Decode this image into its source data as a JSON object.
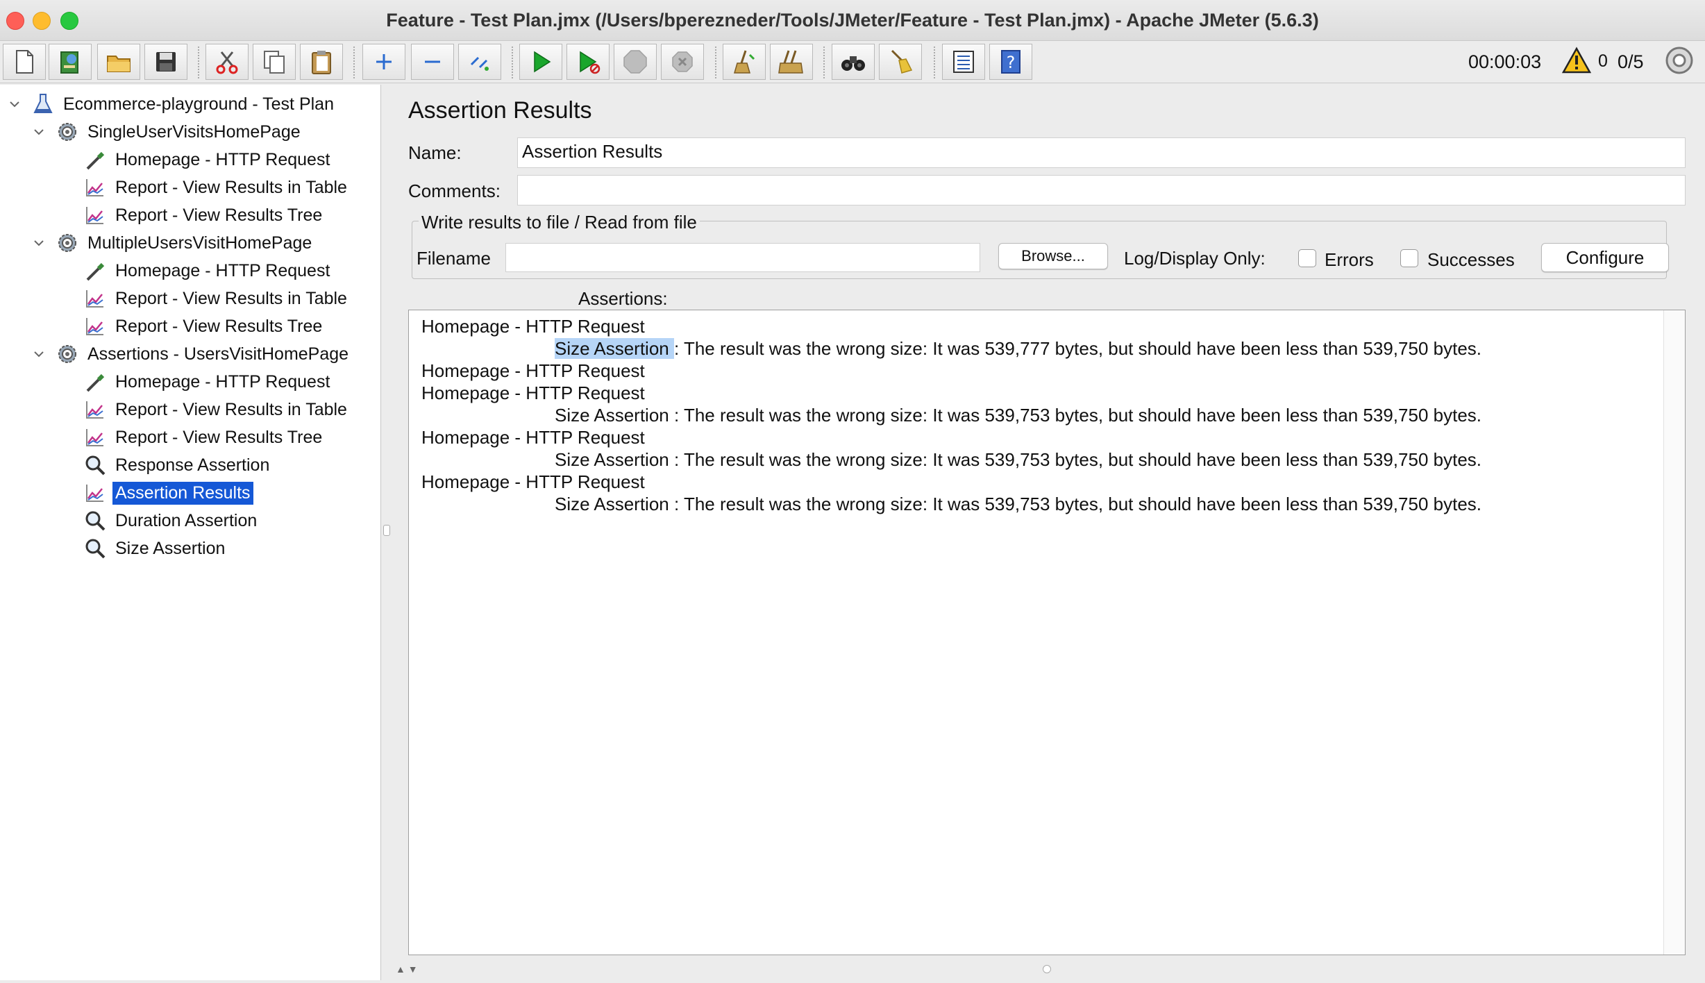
{
  "window": {
    "title": "Feature - Test Plan.jmx (/Users/bperezneder/Tools/JMeter/Feature - Test Plan.jmx) - Apache JMeter (5.6.3)"
  },
  "toolbar": {
    "buttons": [
      "new-icon",
      "templates-icon",
      "open-icon",
      "save-icon",
      "cut-icon",
      "copy-icon",
      "paste-icon",
      "expand-icon",
      "collapse-icon",
      "toggle-icon",
      "start-icon",
      "start-no-pauses-icon",
      "stop-icon",
      "shutdown-icon",
      "clear-icon",
      "clear-all-icon",
      "search-icon",
      "reset-search-icon",
      "function-helper-icon",
      "help-icon"
    ],
    "timer": "00:00:03",
    "warning_count": "0",
    "threads": "0/5"
  },
  "tree": {
    "items": [
      {
        "label": "Ecommerce-playground - Test Plan",
        "icon": "flask-icon",
        "level": 0,
        "expanded": true
      },
      {
        "label": "SingleUserVisitsHomePage",
        "icon": "gear-icon",
        "level": 1,
        "expanded": true
      },
      {
        "label": "Homepage - HTTP Request",
        "icon": "pipette-icon",
        "level": 2
      },
      {
        "label": "Report - View Results in Table",
        "icon": "graph-icon",
        "level": 2
      },
      {
        "label": "Report - View Results Tree",
        "icon": "graph-icon",
        "level": 2
      },
      {
        "label": "MultipleUsersVisitHomePage",
        "icon": "gear-icon",
        "level": 1,
        "expanded": true
      },
      {
        "label": "Homepage - HTTP Request",
        "icon": "pipette-icon",
        "level": 2
      },
      {
        "label": "Report - View Results in Table",
        "icon": "graph-icon",
        "level": 2
      },
      {
        "label": "Report - View Results Tree",
        "icon": "graph-icon",
        "level": 2
      },
      {
        "label": "Assertions - UsersVisitHomePage",
        "icon": "gear-icon",
        "level": 1,
        "expanded": true
      },
      {
        "label": "Homepage - HTTP Request",
        "icon": "pipette-icon",
        "level": 2
      },
      {
        "label": "Report - View Results in Table",
        "icon": "graph-icon",
        "level": 2
      },
      {
        "label": "Report - View Results Tree",
        "icon": "graph-icon",
        "level": 2
      },
      {
        "label": "Response Assertion",
        "icon": "magnifier-icon",
        "level": 2
      },
      {
        "label": "Assertion Results",
        "icon": "graph-icon",
        "level": 2,
        "selected": true
      },
      {
        "label": "Duration Assertion",
        "icon": "magnifier-icon",
        "level": 2
      },
      {
        "label": "Size Assertion",
        "icon": "magnifier-icon",
        "level": 2
      }
    ]
  },
  "panel": {
    "title": "Assertion Results",
    "name_label": "Name:",
    "name_value": "Assertion Results",
    "comments_label": "Comments:",
    "comments_value": "",
    "file_group_title": "Write results to file / Read from file",
    "filename_label": "Filename",
    "filename_value": "",
    "browse_label": "Browse...",
    "log_display_label": "Log/Display Only:",
    "errors_label": "Errors",
    "successes_label": "Successes",
    "configure_label": "Configure",
    "assertions_label": "Assertions:"
  },
  "results": [
    {
      "sampler": "Homepage - HTTP Request",
      "assertion": "Size Assertion",
      "message": ": The result was the wrong size: It was 539,777 bytes, but should have been less than 539,750 bytes.",
      "highlight": true
    },
    {
      "sampler": "Homepage - HTTP Request"
    },
    {
      "sampler": "Homepage - HTTP Request",
      "assertion": "Size Assertion",
      "message": ": The result was the wrong size: It was 539,753 bytes, but should have been less than 539,750 bytes."
    },
    {
      "sampler": "Homepage - HTTP Request",
      "assertion": "Size Assertion",
      "message": ": The result was the wrong size: It was 539,753 bytes, but should have been less than 539,750 bytes."
    },
    {
      "sampler": "Homepage - HTTP Request",
      "assertion": "Size Assertion",
      "message": ": The result was the wrong size: It was 539,753 bytes, but should have been less than 539,750 bytes."
    }
  ],
  "colors": {
    "selection": "#1558d6",
    "text_highlight": "#b6d5f7",
    "run_green": "#1aa62c"
  }
}
